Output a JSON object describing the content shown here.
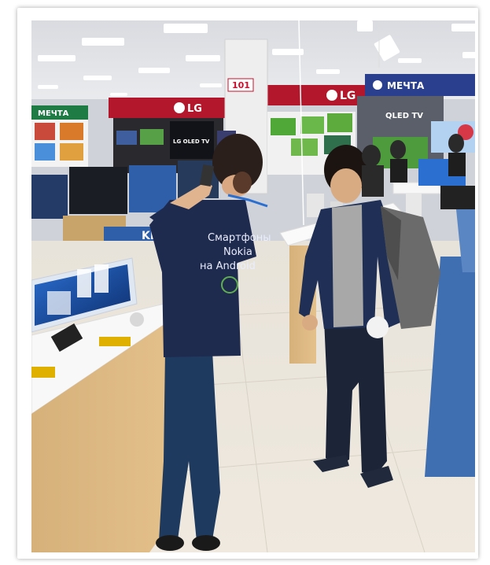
{
  "photo": {
    "signs": {
      "mvideo_left": "МЕЧТА",
      "mvideo_right": "МЕЧТА",
      "lg_center": "LG",
      "lg_right": "LG",
      "qled": "QLED TV",
      "lg_oled": "LG OLED TV",
      "aisle_number": "101",
      "kivi": "KIVI"
    },
    "shirt": {
      "line1": "Смартфоны",
      "line2": "Nokia",
      "line3": "на Android"
    }
  },
  "colors": {
    "sign_red": "#c8102e",
    "sign_blue": "#2b3f8f",
    "shirt_navy": "#1f2a4f",
    "floor_blue": "#3f6fb0"
  }
}
